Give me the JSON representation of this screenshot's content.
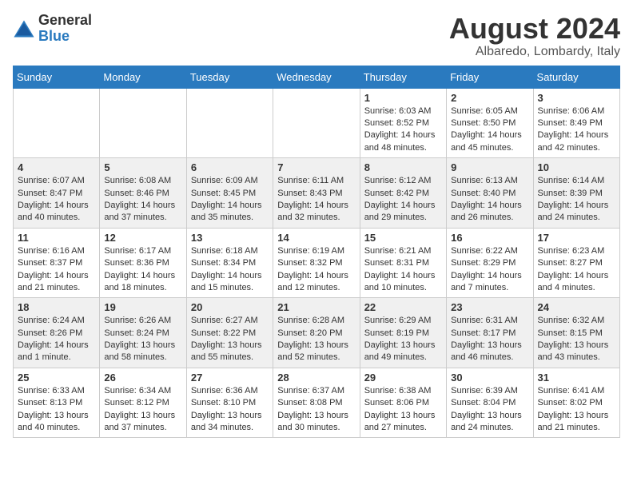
{
  "logo": {
    "general": "General",
    "blue": "Blue"
  },
  "title": "August 2024",
  "location": "Albaredo, Lombardy, Italy",
  "days_of_week": [
    "Sunday",
    "Monday",
    "Tuesday",
    "Wednesday",
    "Thursday",
    "Friday",
    "Saturday"
  ],
  "weeks": [
    [
      {
        "day": "",
        "info": ""
      },
      {
        "day": "",
        "info": ""
      },
      {
        "day": "",
        "info": ""
      },
      {
        "day": "",
        "info": ""
      },
      {
        "day": "1",
        "info": "Sunrise: 6:03 AM\nSunset: 8:52 PM\nDaylight: 14 hours\nand 48 minutes."
      },
      {
        "day": "2",
        "info": "Sunrise: 6:05 AM\nSunset: 8:50 PM\nDaylight: 14 hours\nand 45 minutes."
      },
      {
        "day": "3",
        "info": "Sunrise: 6:06 AM\nSunset: 8:49 PM\nDaylight: 14 hours\nand 42 minutes."
      }
    ],
    [
      {
        "day": "4",
        "info": "Sunrise: 6:07 AM\nSunset: 8:47 PM\nDaylight: 14 hours\nand 40 minutes."
      },
      {
        "day": "5",
        "info": "Sunrise: 6:08 AM\nSunset: 8:46 PM\nDaylight: 14 hours\nand 37 minutes."
      },
      {
        "day": "6",
        "info": "Sunrise: 6:09 AM\nSunset: 8:45 PM\nDaylight: 14 hours\nand 35 minutes."
      },
      {
        "day": "7",
        "info": "Sunrise: 6:11 AM\nSunset: 8:43 PM\nDaylight: 14 hours\nand 32 minutes."
      },
      {
        "day": "8",
        "info": "Sunrise: 6:12 AM\nSunset: 8:42 PM\nDaylight: 14 hours\nand 29 minutes."
      },
      {
        "day": "9",
        "info": "Sunrise: 6:13 AM\nSunset: 8:40 PM\nDaylight: 14 hours\nand 26 minutes."
      },
      {
        "day": "10",
        "info": "Sunrise: 6:14 AM\nSunset: 8:39 PM\nDaylight: 14 hours\nand 24 minutes."
      }
    ],
    [
      {
        "day": "11",
        "info": "Sunrise: 6:16 AM\nSunset: 8:37 PM\nDaylight: 14 hours\nand 21 minutes."
      },
      {
        "day": "12",
        "info": "Sunrise: 6:17 AM\nSunset: 8:36 PM\nDaylight: 14 hours\nand 18 minutes."
      },
      {
        "day": "13",
        "info": "Sunrise: 6:18 AM\nSunset: 8:34 PM\nDaylight: 14 hours\nand 15 minutes."
      },
      {
        "day": "14",
        "info": "Sunrise: 6:19 AM\nSunset: 8:32 PM\nDaylight: 14 hours\nand 12 minutes."
      },
      {
        "day": "15",
        "info": "Sunrise: 6:21 AM\nSunset: 8:31 PM\nDaylight: 14 hours\nand 10 minutes."
      },
      {
        "day": "16",
        "info": "Sunrise: 6:22 AM\nSunset: 8:29 PM\nDaylight: 14 hours\nand 7 minutes."
      },
      {
        "day": "17",
        "info": "Sunrise: 6:23 AM\nSunset: 8:27 PM\nDaylight: 14 hours\nand 4 minutes."
      }
    ],
    [
      {
        "day": "18",
        "info": "Sunrise: 6:24 AM\nSunset: 8:26 PM\nDaylight: 14 hours\nand 1 minute."
      },
      {
        "day": "19",
        "info": "Sunrise: 6:26 AM\nSunset: 8:24 PM\nDaylight: 13 hours\nand 58 minutes."
      },
      {
        "day": "20",
        "info": "Sunrise: 6:27 AM\nSunset: 8:22 PM\nDaylight: 13 hours\nand 55 minutes."
      },
      {
        "day": "21",
        "info": "Sunrise: 6:28 AM\nSunset: 8:20 PM\nDaylight: 13 hours\nand 52 minutes."
      },
      {
        "day": "22",
        "info": "Sunrise: 6:29 AM\nSunset: 8:19 PM\nDaylight: 13 hours\nand 49 minutes."
      },
      {
        "day": "23",
        "info": "Sunrise: 6:31 AM\nSunset: 8:17 PM\nDaylight: 13 hours\nand 46 minutes."
      },
      {
        "day": "24",
        "info": "Sunrise: 6:32 AM\nSunset: 8:15 PM\nDaylight: 13 hours\nand 43 minutes."
      }
    ],
    [
      {
        "day": "25",
        "info": "Sunrise: 6:33 AM\nSunset: 8:13 PM\nDaylight: 13 hours\nand 40 minutes."
      },
      {
        "day": "26",
        "info": "Sunrise: 6:34 AM\nSunset: 8:12 PM\nDaylight: 13 hours\nand 37 minutes."
      },
      {
        "day": "27",
        "info": "Sunrise: 6:36 AM\nSunset: 8:10 PM\nDaylight: 13 hours\nand 34 minutes."
      },
      {
        "day": "28",
        "info": "Sunrise: 6:37 AM\nSunset: 8:08 PM\nDaylight: 13 hours\nand 30 minutes."
      },
      {
        "day": "29",
        "info": "Sunrise: 6:38 AM\nSunset: 8:06 PM\nDaylight: 13 hours\nand 27 minutes."
      },
      {
        "day": "30",
        "info": "Sunrise: 6:39 AM\nSunset: 8:04 PM\nDaylight: 13 hours\nand 24 minutes."
      },
      {
        "day": "31",
        "info": "Sunrise: 6:41 AM\nSunset: 8:02 PM\nDaylight: 13 hours\nand 21 minutes."
      }
    ]
  ]
}
